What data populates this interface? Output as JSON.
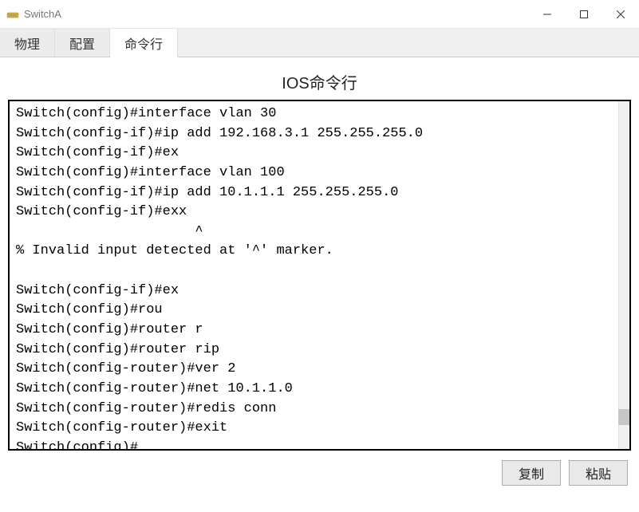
{
  "window": {
    "title": "SwitchA"
  },
  "tabs": {
    "physical": "物理",
    "config": "配置",
    "cli": "命令行"
  },
  "section": {
    "title": "IOS命令行"
  },
  "terminal": {
    "content": "Switch(config)#interface vlan 30\nSwitch(config-if)#ip add 192.168.3.1 255.255.255.0\nSwitch(config-if)#ex\nSwitch(config)#interface vlan 100\nSwitch(config-if)#ip add 10.1.1.1 255.255.255.0\nSwitch(config-if)#exx\n                      ^\n% Invalid input detected at '^' marker.\n\nSwitch(config-if)#ex\nSwitch(config)#rou\nSwitch(config)#router r\nSwitch(config)#router rip\nSwitch(config-router)#ver 2\nSwitch(config-router)#net 10.1.1.0\nSwitch(config-router)#redis conn\nSwitch(config-router)#exit\nSwitch(config)#"
  },
  "buttons": {
    "copy": "复制",
    "paste": "粘贴"
  }
}
